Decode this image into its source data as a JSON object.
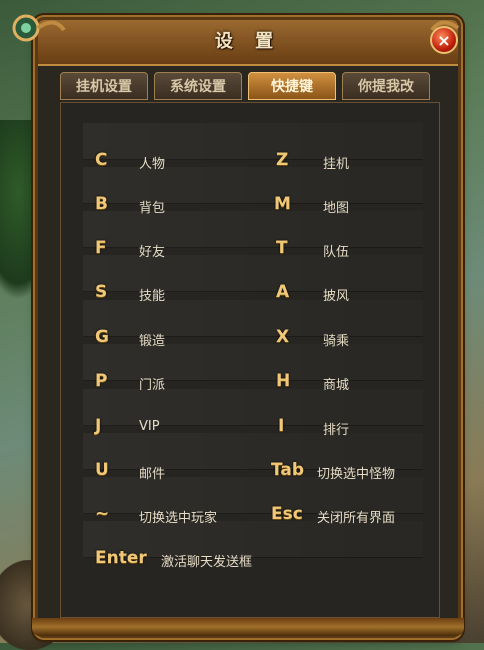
{
  "window": {
    "title": "设 置",
    "close_icon": "×"
  },
  "tabs": [
    {
      "label": "挂机设置",
      "active": false
    },
    {
      "label": "系统设置",
      "active": false
    },
    {
      "label": "快捷键",
      "active": true
    },
    {
      "label": "你提我改",
      "active": false
    }
  ],
  "shortcuts": {
    "left": [
      {
        "key": "C",
        "desc": "人物"
      },
      {
        "key": "B",
        "desc": "背包"
      },
      {
        "key": "F",
        "desc": "好友"
      },
      {
        "key": "S",
        "desc": "技能"
      },
      {
        "key": "G",
        "desc": "锻造"
      },
      {
        "key": "P",
        "desc": "门派"
      },
      {
        "key": "J",
        "desc": "VIP"
      },
      {
        "key": "U",
        "desc": "邮件"
      },
      {
        "key": "~",
        "desc": "切换选中玩家"
      },
      {
        "key": "Enter",
        "desc": "激活聊天发送框"
      }
    ],
    "right": [
      {
        "key": "Z",
        "desc": "挂机"
      },
      {
        "key": "M",
        "desc": "地图"
      },
      {
        "key": "T",
        "desc": "队伍"
      },
      {
        "key": "A",
        "desc": "披风"
      },
      {
        "key": "X",
        "desc": "骑乘"
      },
      {
        "key": "H",
        "desc": "商城"
      },
      {
        "key": "I",
        "desc": "排行"
      },
      {
        "key": "Tab",
        "desc": "切换选中怪物"
      },
      {
        "key": "Esc",
        "desc": "关闭所有界面"
      }
    ]
  }
}
